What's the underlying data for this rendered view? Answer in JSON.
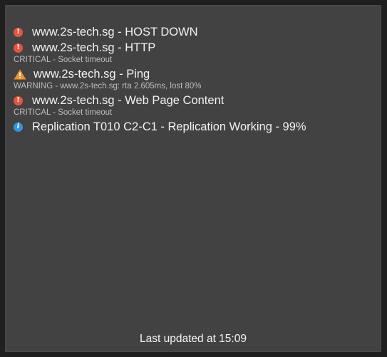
{
  "alerts": [
    {
      "severity": "critical",
      "icon": "exclamation-circle-icon",
      "title": "www.2s-tech.sg - HOST DOWN",
      "detail": ""
    },
    {
      "severity": "critical",
      "icon": "exclamation-circle-icon",
      "title": "www.2s-tech.sg - HTTP",
      "detail": "CRITICAL - Socket timeout"
    },
    {
      "severity": "warning",
      "icon": "warning-triangle-icon",
      "title": "www.2s-tech.sg - Ping",
      "detail": "WARNING - www.2s-tech.sg: rta 2.605ms, lost 80%"
    },
    {
      "severity": "critical",
      "icon": "exclamation-circle-icon",
      "title": "www.2s-tech.sg - Web Page Content",
      "detail": "CRITICAL - Socket timeout"
    },
    {
      "severity": "info",
      "icon": "info-circle-icon",
      "title": "Replication T010 C2-C1 - Replication Working - 99%",
      "detail": ""
    }
  ],
  "footer": {
    "last_updated": "Last updated at 15:09"
  },
  "colors": {
    "critical": "#e8543f",
    "warning": "#f0922b",
    "info": "#2f97e0",
    "panel_bg": "#424242",
    "outer_bg": "#1f1f1f"
  }
}
